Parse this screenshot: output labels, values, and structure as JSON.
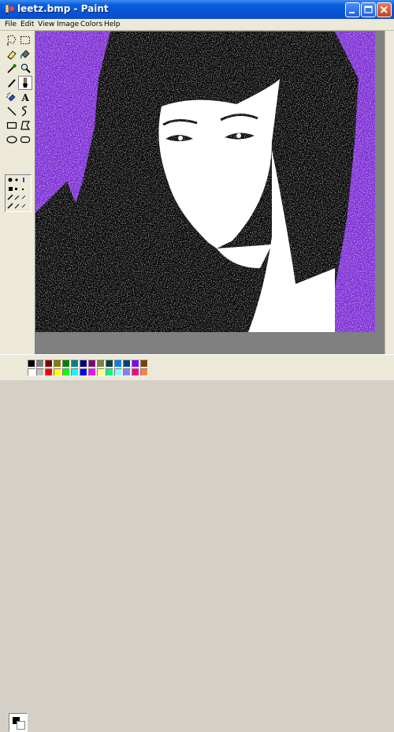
{
  "window": {
    "title": "leetz.bmp - Paint",
    "titlebar_color": "#0a5fde",
    "icons": [
      "paint-app-icon",
      "minimize-icon",
      "maximize-icon",
      "close-icon"
    ]
  },
  "menubar": {
    "items": [
      "File",
      "Edit",
      "View",
      "Image",
      "Colors",
      "Help"
    ]
  },
  "toolbox": {
    "tools": [
      {
        "name": "free-form-select-icon"
      },
      {
        "name": "select-icon"
      },
      {
        "name": "eraser-icon"
      },
      {
        "name": "fill-with-color-icon"
      },
      {
        "name": "pick-color-icon"
      },
      {
        "name": "magnifier-icon"
      },
      {
        "name": "pencil-icon"
      },
      {
        "name": "brush-icon",
        "active": true
      },
      {
        "name": "airbrush-icon"
      },
      {
        "name": "text-icon"
      },
      {
        "name": "line-icon"
      },
      {
        "name": "curve-icon"
      },
      {
        "name": "rectangle-icon"
      },
      {
        "name": "polygon-icon"
      },
      {
        "name": "ellipse-icon"
      },
      {
        "name": "rounded-rectangle-icon"
      }
    ],
    "text_tool_glyph": "A"
  },
  "canvas": {
    "image": "leetz.bmp artwork: black-and-white portrait with purple background",
    "background_color": "#7a2ad4",
    "hair_color": "#000000",
    "skin_color": "#ffffff"
  },
  "palette": {
    "primary_color": "#000000",
    "secondary_color": "#ffffff",
    "row1": [
      "#000000",
      "#808080",
      "#800000",
      "#808000",
      "#008000",
      "#008080",
      "#000080",
      "#800080",
      "#808040",
      "#004040",
      "#0080ff",
      "#004080",
      "#8000ff",
      "#804000"
    ],
    "row2": [
      "#ffffff",
      "#c0c0c0",
      "#ff0000",
      "#ffff00",
      "#00ff00",
      "#00ffff",
      "#0000ff",
      "#ff00ff",
      "#ffff80",
      "#00ff80",
      "#80ffff",
      "#8080ff",
      "#ff0080",
      "#ff8040"
    ]
  }
}
